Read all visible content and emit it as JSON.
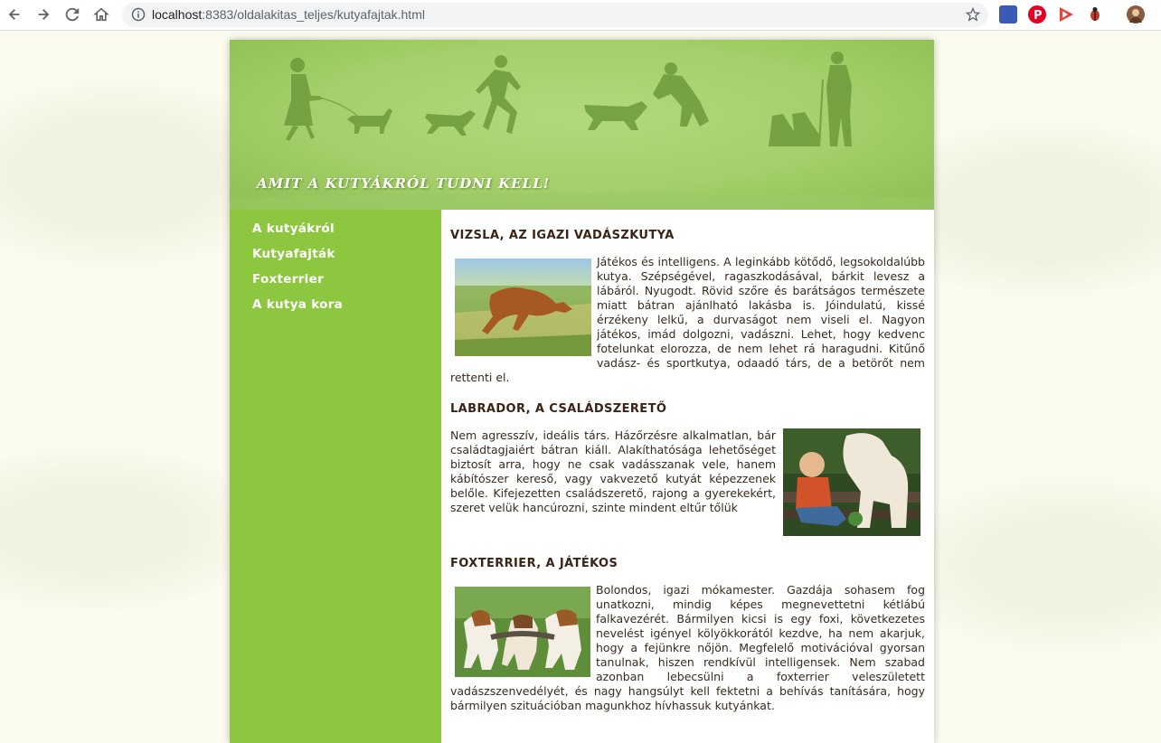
{
  "browser": {
    "url_host": "localhost",
    "url_rest": ":8383/oldalakitas_teljes/kutyafajtak.html",
    "extensions": [
      "cube-extension-icon",
      "pinterest-icon",
      "play-extension-icon",
      "bug-extension-icon",
      "profile-avatar"
    ]
  },
  "banner": {
    "title": "AMIT A KUTYÁKRÓL TUDNI KELL!"
  },
  "nav": {
    "items": [
      {
        "label": "A kutyákról"
      },
      {
        "label": "Kutyafajták"
      },
      {
        "label": "Foxterrier"
      },
      {
        "label": "A kutya kora"
      }
    ]
  },
  "articles": [
    {
      "title": "VIZSLA, AZ IGAZI VADÁSZKUTYA",
      "text": "Játékos és intelligens. A leginkább kötődő, legsokoldalúbb kutya. Szépségével, ragaszkodásával, bárkit levesz a lábáról. Nyugodt. Rövid szőre és barátságos természete miatt bátran ajánlható lakásba is. Jóindulatú, kissé érzékeny lelkű, a durvaságot nem viseli el. Nagyon játékos, imád dolgozni, vadászni. Lehet, hogy kedvenc fotelunkat elorozza, de nem lehet rá haragudni. Kitűnő vadász- és sportkutya, odaadó társ, de a betörőt nem rettenti el."
    },
    {
      "title": "LABRADOR, A CSALÁDSZERETŐ",
      "text": "Nem agresszív, ideális társ. Házőrzésre alkalmatlan, bár családtagjaiért bátran kiáll. Alakíthatósága lehetőséget biztosít arra, hogy ne csak vadásszanak vele, hanem kábítószer kereső, vagy vakvezető kutyát képezzenek belőle. Kifejezetten családszerető, rajong a gyerekekért, szeret velük hancúrozni, szinte mindent eltűr tőlük"
    },
    {
      "title": "FOXTERRIER, A JÁTÉKOS",
      "text": "Bolondos, igazi mókamester. Gazdája sohasem fog unatkozni, mindig képes megnevettetni kétlábú falkavezérét. Bármilyen kicsi is egy foxi, következetes nevelést igényel kölyökkorától kezdve, ha nem akarjuk, hogy a fejünkre nőjön. Megfelelő motivációval gyorsan tanulnak, hiszen rendkívül intelligensek. Nem szabad azonban lebecsülni a foxterrier veleszületett vadászszenvedélyét, és nagy hangsúlyt kell fektetni a behívás tanítására, hogy bármilyen szituációban magunkhoz hívhassuk kutyánkat."
    }
  ]
}
